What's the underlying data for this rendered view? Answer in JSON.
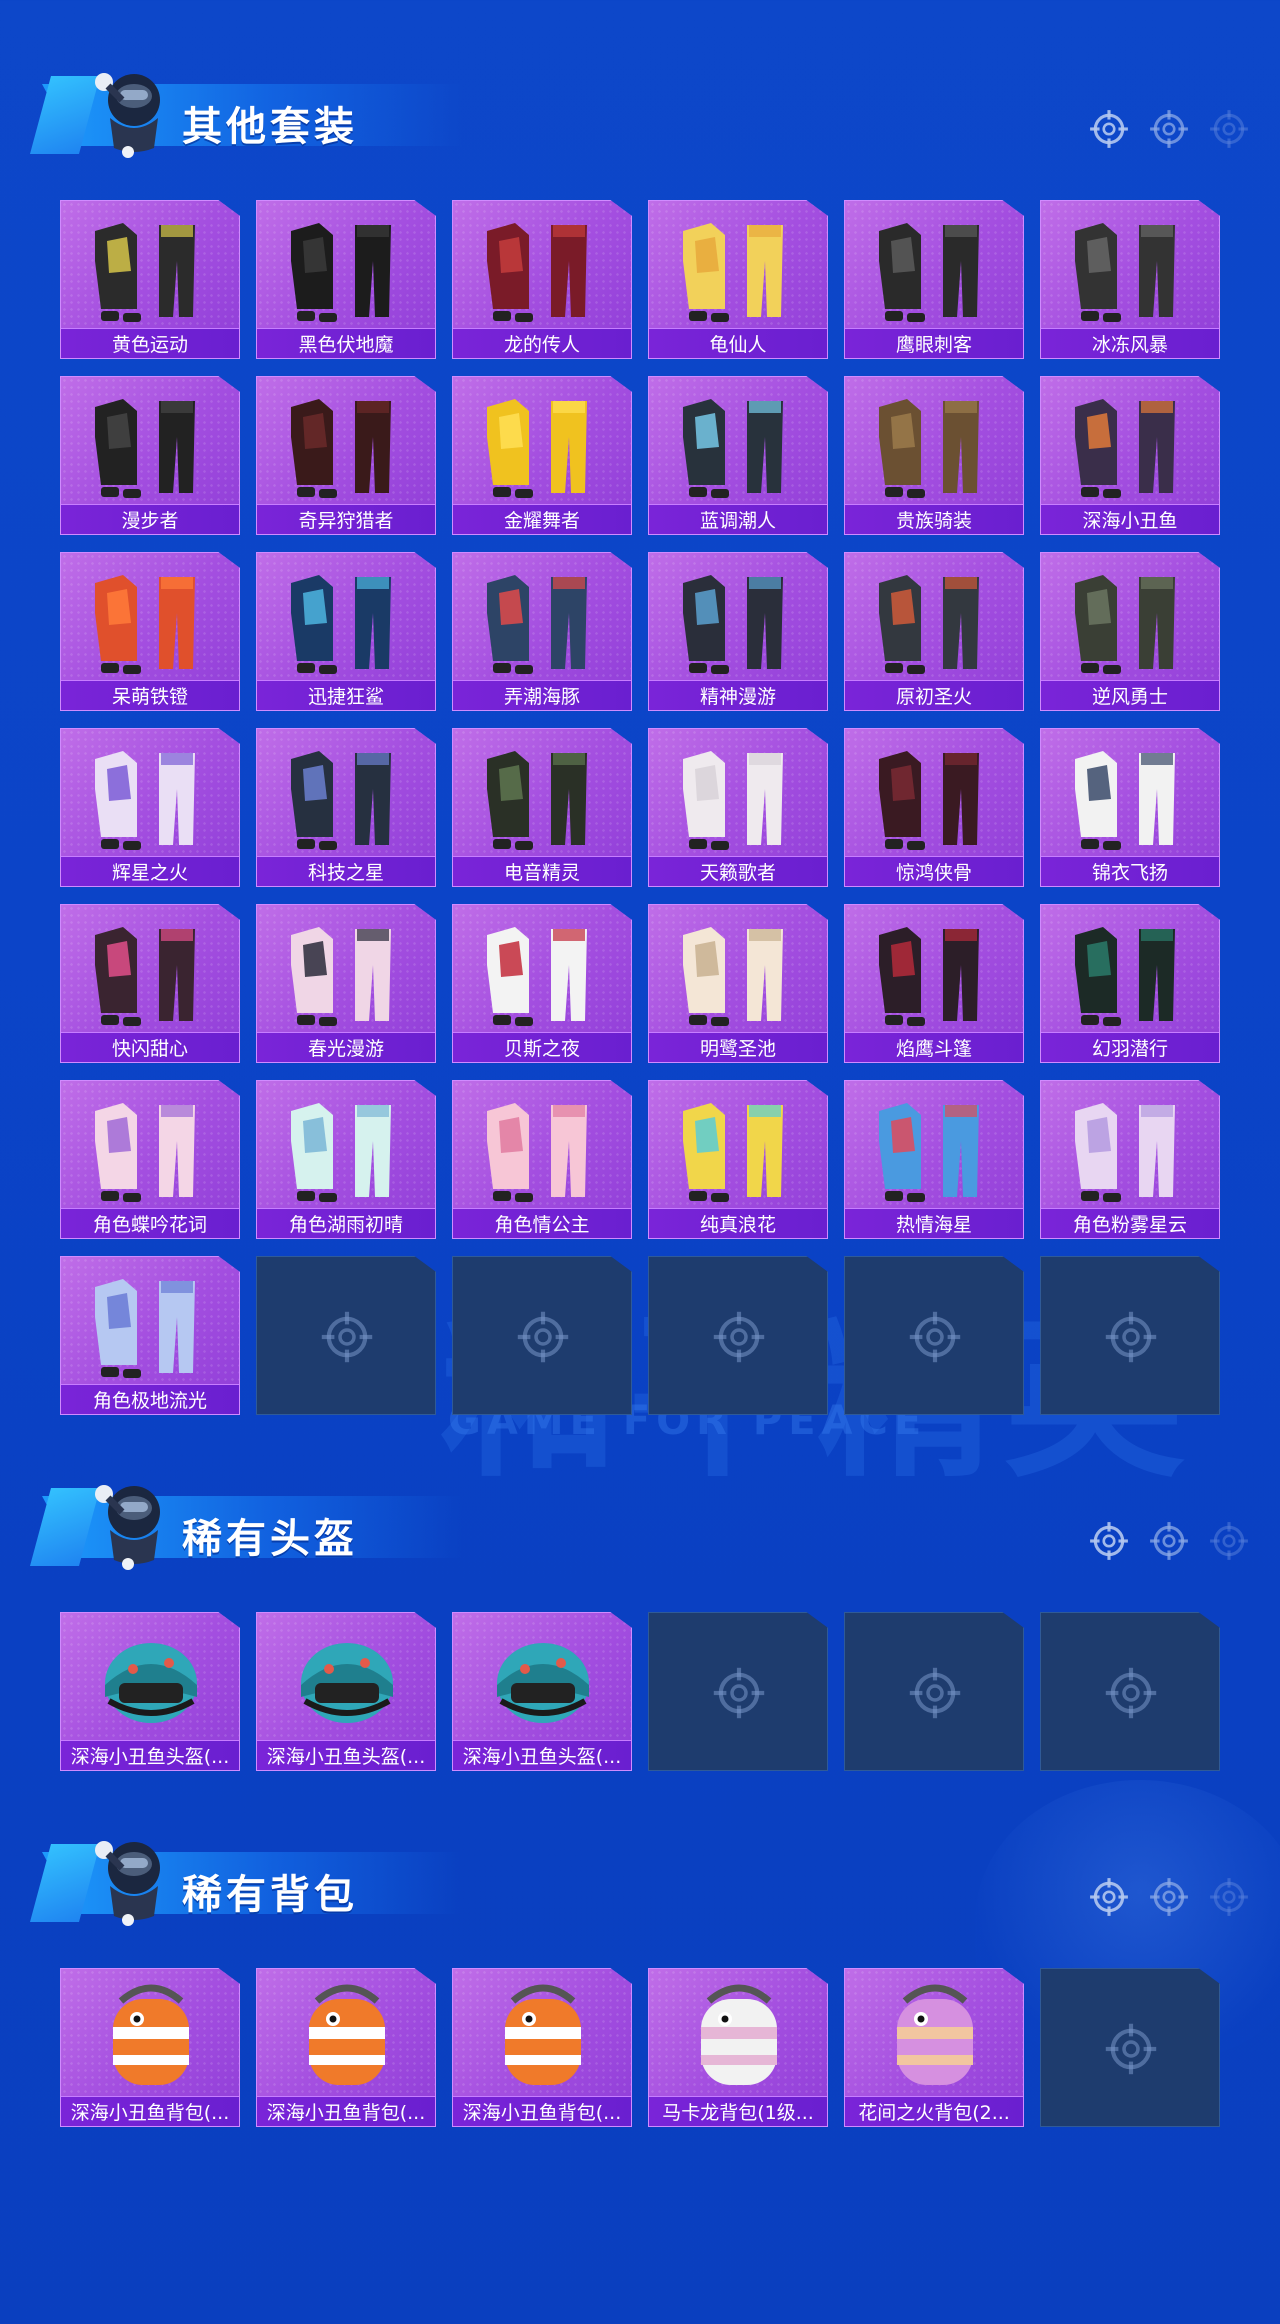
{
  "sections": [
    {
      "title": "其他套装",
      "items": [
        "黄色运动",
        "黑色伏地魔",
        "龙的传人",
        "龟仙人",
        "鹰眼刺客",
        "冰冻风暴",
        "漫步者",
        "奇异狩猎者",
        "金耀舞者",
        "蓝调潮人",
        "贵族骑装",
        "深海小丑鱼",
        "呆萌铁镫",
        "迅捷狂鲨",
        "弄潮海豚",
        "精神漫游",
        "原初圣火",
        "逆风勇士",
        "辉星之火",
        "科技之星",
        "电音精灵",
        "天籁歌者",
        "惊鸿侠骨",
        "锦衣飞扬",
        "快闪甜心",
        "春光漫游",
        "贝斯之夜",
        "明鹭圣池",
        "焰鹰斗篷",
        "幻羽潜行",
        "角色蝶吟花词",
        "角色湖雨初晴",
        "角色情公主",
        "纯真浪花",
        "热情海星",
        "角色粉雾星云",
        "角色极地流光"
      ],
      "empty_slots": 5
    },
    {
      "title": "稀有头盔",
      "items": [
        "深海小丑鱼头盔(...",
        "深海小丑鱼头盔(...",
        "深海小丑鱼头盔(..."
      ],
      "empty_slots": 3
    },
    {
      "title": "稀有背包",
      "items": [
        "深海小丑鱼背包(...",
        "深海小丑鱼背包(...",
        "深海小丑鱼背包(...",
        "马卡龙背包(1级...",
        "花间之火背包(2..."
      ],
      "empty_slots": 1
    }
  ],
  "background_text": "和平精英",
  "background_subtext": "GAME FOR PEACE",
  "colors": {
    "background": "#0b44c8",
    "card_fill": "#a44fe0",
    "label_bar": "#7a24d8",
    "empty_card": "#1e3c6e"
  }
}
